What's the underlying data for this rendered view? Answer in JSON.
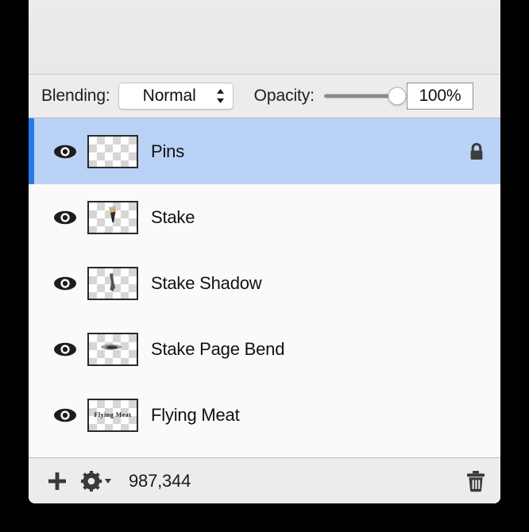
{
  "window": {
    "title": ""
  },
  "controls": {
    "blending_label": "Blending:",
    "blending_value": "Normal",
    "blending_options": [
      "Normal"
    ],
    "opacity_label": "Opacity:",
    "opacity_value": "100%",
    "opacity_percent": 100
  },
  "layers": [
    {
      "name": "Pins",
      "visible": true,
      "locked": true,
      "selected": true,
      "thumbnail": "transparent-checkerboard",
      "eye_icon": "eye-icon",
      "lock_icon": "lock-closed-icon"
    },
    {
      "name": "Stake",
      "visible": true,
      "locked": false,
      "selected": false,
      "thumbnail": "stake-object",
      "eye_icon": "eye-icon"
    },
    {
      "name": "Stake Shadow",
      "visible": true,
      "locked": false,
      "selected": false,
      "thumbnail": "stake-shadow",
      "eye_icon": "eye-icon"
    },
    {
      "name": "Stake Page Bend",
      "visible": true,
      "locked": false,
      "selected": false,
      "thumbnail": "page-bend-smudge",
      "eye_icon": "eye-icon"
    },
    {
      "name": "Flying Meat",
      "visible": true,
      "locked": false,
      "selected": false,
      "thumbnail": "flying-meat-text",
      "thumbnail_text": "Flying Meat",
      "eye_icon": "eye-icon"
    }
  ],
  "toolbar": {
    "add_label": "+",
    "add_icon": "plus-icon",
    "actions_icon": "gear-icon",
    "actions_caret": "chevron-down-icon",
    "count": "987,344",
    "delete_icon": "trash-icon"
  },
  "colors": {
    "selection_background": "#bad2f6",
    "selection_indicator": "#2979e9",
    "list_background": "#fafafa",
    "chrome_background": "#ececec",
    "text": "#111111"
  }
}
